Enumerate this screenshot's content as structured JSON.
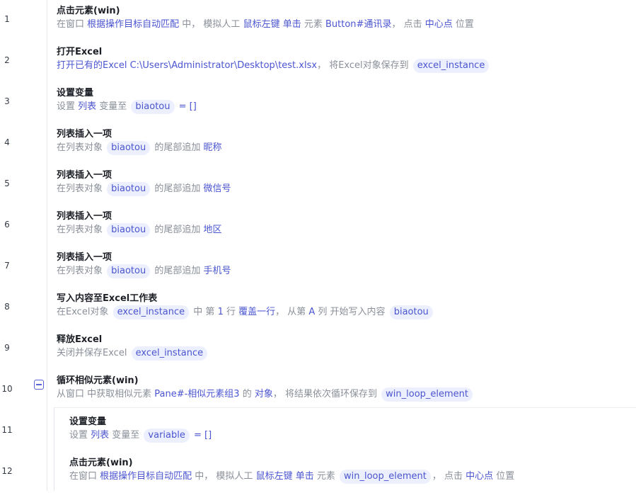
{
  "steps": [
    {
      "num": "1",
      "title": "点击元素(win)",
      "desc": [
        {
          "t": "text",
          "v": "在窗口 "
        },
        {
          "t": "link",
          "v": "根据操作目标自动匹配"
        },
        {
          "t": "text",
          "v": " 中， 模拟人工 "
        },
        {
          "t": "link",
          "v": "鼠标左键"
        },
        {
          "t": "text",
          "v": " "
        },
        {
          "t": "link",
          "v": "单击"
        },
        {
          "t": "text",
          "v": " 元素 "
        },
        {
          "t": "link",
          "v": "Button#通讯录"
        },
        {
          "t": "text",
          "v": "， 点击 "
        },
        {
          "t": "link",
          "v": "中心点"
        },
        {
          "t": "text",
          "v": " 位置"
        }
      ]
    },
    {
      "num": "2",
      "title": "打开Excel",
      "desc": [
        {
          "t": "link",
          "v": "打开已有的Excel"
        },
        {
          "t": "text",
          "v": " "
        },
        {
          "t": "link",
          "v": "C:\\Users\\Administrator\\Desktop\\test.xlsx"
        },
        {
          "t": "text",
          "v": "， 将Excel对象保存到 "
        },
        {
          "t": "pill",
          "v": "excel_instance"
        }
      ]
    },
    {
      "num": "3",
      "title": "设置变量",
      "desc": [
        {
          "t": "text",
          "v": "设置 "
        },
        {
          "t": "link",
          "v": "列表"
        },
        {
          "t": "text",
          "v": " 变量至 "
        },
        {
          "t": "pill",
          "v": "biaotou"
        },
        {
          "t": "text",
          "v": " "
        },
        {
          "t": "link",
          "v": "= []"
        }
      ]
    },
    {
      "num": "4",
      "title": "列表插入一项",
      "desc": [
        {
          "t": "text",
          "v": "在列表对象 "
        },
        {
          "t": "pill",
          "v": "biaotou"
        },
        {
          "t": "text",
          "v": " 的尾部追加 "
        },
        {
          "t": "link",
          "v": "昵称"
        }
      ]
    },
    {
      "num": "5",
      "title": "列表插入一项",
      "desc": [
        {
          "t": "text",
          "v": "在列表对象 "
        },
        {
          "t": "pill",
          "v": "biaotou"
        },
        {
          "t": "text",
          "v": " 的尾部追加 "
        },
        {
          "t": "link",
          "v": "微信号"
        }
      ]
    },
    {
      "num": "6",
      "title": "列表插入一项",
      "desc": [
        {
          "t": "text",
          "v": "在列表对象 "
        },
        {
          "t": "pill",
          "v": "biaotou"
        },
        {
          "t": "text",
          "v": " 的尾部追加 "
        },
        {
          "t": "link",
          "v": "地区"
        }
      ]
    },
    {
      "num": "7",
      "title": "列表插入一项",
      "desc": [
        {
          "t": "text",
          "v": "在列表对象 "
        },
        {
          "t": "pill",
          "v": "biaotou"
        },
        {
          "t": "text",
          "v": " 的尾部追加 "
        },
        {
          "t": "link",
          "v": "手机号"
        }
      ]
    },
    {
      "num": "8",
      "title": "写入内容至Excel工作表",
      "desc": [
        {
          "t": "text",
          "v": "在Excel对象 "
        },
        {
          "t": "pill",
          "v": "excel_instance"
        },
        {
          "t": "text",
          "v": " 中 第 "
        },
        {
          "t": "link",
          "v": "1"
        },
        {
          "t": "text",
          "v": " 行 "
        },
        {
          "t": "link",
          "v": "覆盖一行"
        },
        {
          "t": "text",
          "v": "， 从第 "
        },
        {
          "t": "link",
          "v": "A"
        },
        {
          "t": "text",
          "v": " 列 开始写入内容 "
        },
        {
          "t": "pill",
          "v": "biaotou"
        }
      ]
    },
    {
      "num": "9",
      "title": "释放Excel",
      "desc": [
        {
          "t": "text",
          "v": "关闭并保存Excel "
        },
        {
          "t": "pill",
          "v": "excel_instance"
        }
      ]
    },
    {
      "num": "10",
      "title": "循环相似元素(win)",
      "collapsible": true,
      "desc": [
        {
          "t": "text",
          "v": "从窗口 中获取相似元素 "
        },
        {
          "t": "link",
          "v": "Pane#-相似元素组3"
        },
        {
          "t": "text",
          "v": " 的 "
        },
        {
          "t": "link",
          "v": "对象"
        },
        {
          "t": "text",
          "v": "， 将结果依次循环保存到 "
        },
        {
          "t": "pill",
          "v": "win_loop_element"
        }
      ]
    },
    {
      "num": "11",
      "title": "设置变量",
      "indent": true,
      "desc": [
        {
          "t": "text",
          "v": "设置 "
        },
        {
          "t": "link",
          "v": "列表"
        },
        {
          "t": "text",
          "v": " 变量至 "
        },
        {
          "t": "pill",
          "v": "variable"
        },
        {
          "t": "text",
          "v": " "
        },
        {
          "t": "link",
          "v": "= []"
        }
      ]
    },
    {
      "num": "12",
      "title": "点击元素(win)",
      "indent": true,
      "desc": [
        {
          "t": "text",
          "v": "在窗口 "
        },
        {
          "t": "link",
          "v": "根据操作目标自动匹配"
        },
        {
          "t": "text",
          "v": " 中， 模拟人工 "
        },
        {
          "t": "link",
          "v": "鼠标左键"
        },
        {
          "t": "text",
          "v": " "
        },
        {
          "t": "link",
          "v": "单击"
        },
        {
          "t": "text",
          "v": " 元素 "
        },
        {
          "t": "pill",
          "v": "win_loop_element"
        },
        {
          "t": "text",
          "v": "， 点击 "
        },
        {
          "t": "link",
          "v": "中心点"
        },
        {
          "t": "text",
          "v": " 位置"
        }
      ]
    }
  ]
}
